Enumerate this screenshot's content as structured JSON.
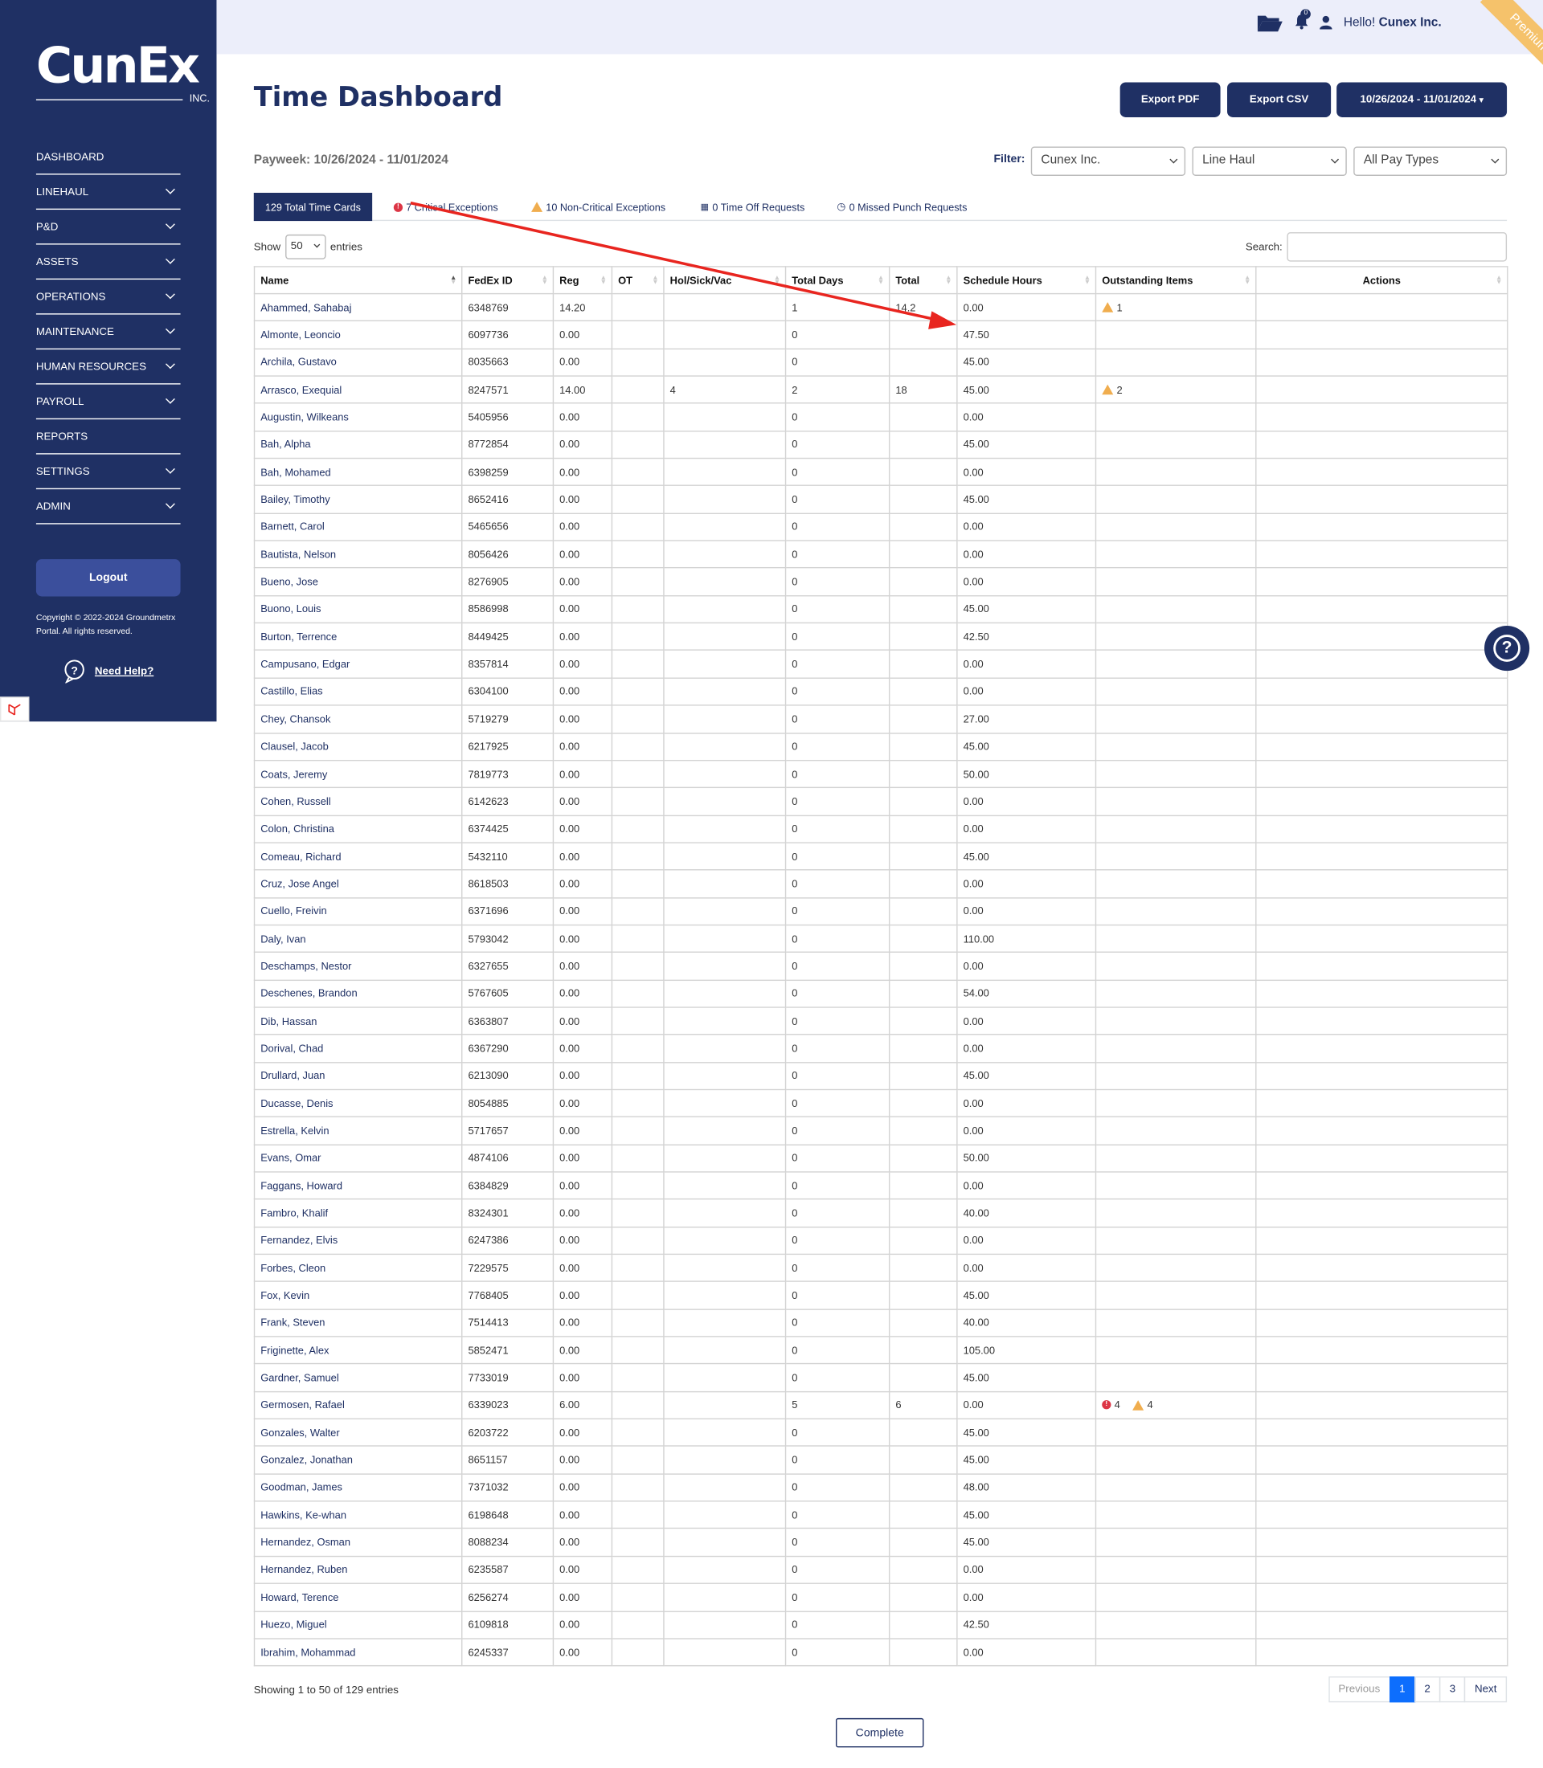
{
  "logo": {
    "word": "CunEx",
    "suffix": "INC."
  },
  "sidebar": {
    "items": [
      {
        "label": "DASHBOARD",
        "chevron": false
      },
      {
        "label": "LINEHAUL",
        "chevron": true
      },
      {
        "label": "P&D",
        "chevron": true
      },
      {
        "label": "ASSETS",
        "chevron": true
      },
      {
        "label": "OPERATIONS",
        "chevron": true
      },
      {
        "label": "MAINTENANCE",
        "chevron": true
      },
      {
        "label": "HUMAN RESOURCES",
        "chevron": true
      },
      {
        "label": "PAYROLL",
        "chevron": true
      },
      {
        "label": "REPORTS",
        "chevron": false
      },
      {
        "label": "SETTINGS",
        "chevron": true
      },
      {
        "label": "ADMIN",
        "chevron": true
      }
    ],
    "logout": "Logout",
    "copyright": "Copyright © 2022-2024 Groundmetrx Portal. All rights reserved.",
    "help": "Need Help?"
  },
  "topbar": {
    "greeting": "Hello!",
    "company": "Cunex Inc.",
    "notification_count": "0",
    "ribbon": "Premium +"
  },
  "page": {
    "title": "Time Dashboard",
    "export_pdf": "Export PDF",
    "export_csv": "Export CSV",
    "date_range": "10/26/2024 - 11/01/2024",
    "payweek_label": "Payweek:",
    "payweek": "10/26/2024 - 11/01/2024",
    "filter_label": "Filter:",
    "filter_company": "Cunex Inc.",
    "filter_dept": "Line Haul",
    "filter_pay": "All Pay Types"
  },
  "tabs": [
    {
      "label": "129 Total Time Cards"
    },
    {
      "label": "7 Critical Exceptions"
    },
    {
      "label": "10 Non-Critical Exceptions"
    },
    {
      "label": "0 Time Off Requests"
    },
    {
      "label": "0 Missed Punch Requests"
    }
  ],
  "table": {
    "show_label": "Show",
    "entries_value": "50",
    "entries_label": "entries",
    "search_label": "Search:",
    "columns": [
      "Name",
      "FedEx ID",
      "Reg",
      "OT",
      "Hol/Sick/Vac",
      "Total Days",
      "Total",
      "Schedule Hours",
      "Outstanding Items",
      "Actions"
    ],
    "rows": [
      [
        "Ahammed, Sahabaj",
        "6348769",
        "14.20",
        "",
        "",
        "1",
        "14.2",
        "0.00",
        "",
        "1"
      ],
      [
        "Almonte, Leoncio",
        "6097736",
        "0.00",
        "",
        "",
        "0",
        "",
        "47.50",
        "",
        ""
      ],
      [
        "Archila, Gustavo",
        "8035663",
        "0.00",
        "",
        "",
        "0",
        "",
        "45.00",
        "",
        ""
      ],
      [
        "Arrasco, Exequial",
        "8247571",
        "14.00",
        "",
        "4",
        "2",
        "18",
        "45.00",
        "",
        "2"
      ],
      [
        "Augustin, Wilkeans",
        "5405956",
        "0.00",
        "",
        "",
        "0",
        "",
        "0.00",
        "",
        ""
      ],
      [
        "Bah, Alpha",
        "8772854",
        "0.00",
        "",
        "",
        "0",
        "",
        "45.00",
        "",
        ""
      ],
      [
        "Bah, Mohamed",
        "6398259",
        "0.00",
        "",
        "",
        "0",
        "",
        "0.00",
        "",
        ""
      ],
      [
        "Bailey, Timothy",
        "8652416",
        "0.00",
        "",
        "",
        "0",
        "",
        "45.00",
        "",
        ""
      ],
      [
        "Barnett, Carol",
        "5465656",
        "0.00",
        "",
        "",
        "0",
        "",
        "0.00",
        "",
        ""
      ],
      [
        "Bautista, Nelson",
        "8056426",
        "0.00",
        "",
        "",
        "0",
        "",
        "0.00",
        "",
        ""
      ],
      [
        "Bueno, Jose",
        "8276905",
        "0.00",
        "",
        "",
        "0",
        "",
        "0.00",
        "",
        ""
      ],
      [
        "Buono, Louis",
        "8586998",
        "0.00",
        "",
        "",
        "0",
        "",
        "45.00",
        "",
        ""
      ],
      [
        "Burton, Terrence",
        "8449425",
        "0.00",
        "",
        "",
        "0",
        "",
        "42.50",
        "",
        ""
      ],
      [
        "Campusano, Edgar",
        "8357814",
        "0.00",
        "",
        "",
        "0",
        "",
        "0.00",
        "",
        ""
      ],
      [
        "Castillo, Elias",
        "6304100",
        "0.00",
        "",
        "",
        "0",
        "",
        "0.00",
        "",
        ""
      ],
      [
        "Chey, Chansok",
        "5719279",
        "0.00",
        "",
        "",
        "0",
        "",
        "27.00",
        "",
        ""
      ],
      [
        "Clausel, Jacob",
        "6217925",
        "0.00",
        "",
        "",
        "0",
        "",
        "45.00",
        "",
        ""
      ],
      [
        "Coats, Jeremy",
        "7819773",
        "0.00",
        "",
        "",
        "0",
        "",
        "50.00",
        "",
        ""
      ],
      [
        "Cohen, Russell",
        "6142623",
        "0.00",
        "",
        "",
        "0",
        "",
        "0.00",
        "",
        ""
      ],
      [
        "Colon, Christina",
        "6374425",
        "0.00",
        "",
        "",
        "0",
        "",
        "0.00",
        "",
        ""
      ],
      [
        "Comeau, Richard",
        "5432110",
        "0.00",
        "",
        "",
        "0",
        "",
        "45.00",
        "",
        ""
      ],
      [
        "Cruz, Jose Angel",
        "8618503",
        "0.00",
        "",
        "",
        "0",
        "",
        "0.00",
        "",
        ""
      ],
      [
        "Cuello, Freivin",
        "6371696",
        "0.00",
        "",
        "",
        "0",
        "",
        "0.00",
        "",
        ""
      ],
      [
        "Daly, Ivan",
        "5793042",
        "0.00",
        "",
        "",
        "0",
        "",
        "110.00",
        "",
        ""
      ],
      [
        "Deschamps, Nestor",
        "6327655",
        "0.00",
        "",
        "",
        "0",
        "",
        "0.00",
        "",
        ""
      ],
      [
        "Deschenes, Brandon",
        "5767605",
        "0.00",
        "",
        "",
        "0",
        "",
        "54.00",
        "",
        ""
      ],
      [
        "Dib, Hassan",
        "6363807",
        "0.00",
        "",
        "",
        "0",
        "",
        "0.00",
        "",
        ""
      ],
      [
        "Dorival, Chad",
        "6367290",
        "0.00",
        "",
        "",
        "0",
        "",
        "0.00",
        "",
        ""
      ],
      [
        "Drullard, Juan",
        "6213090",
        "0.00",
        "",
        "",
        "0",
        "",
        "45.00",
        "",
        ""
      ],
      [
        "Ducasse, Denis",
        "8054885",
        "0.00",
        "",
        "",
        "0",
        "",
        "0.00",
        "",
        ""
      ],
      [
        "Estrella, Kelvin",
        "5717657",
        "0.00",
        "",
        "",
        "0",
        "",
        "0.00",
        "",
        ""
      ],
      [
        "Evans, Omar",
        "4874106",
        "0.00",
        "",
        "",
        "0",
        "",
        "50.00",
        "",
        ""
      ],
      [
        "Faggans, Howard",
        "6384829",
        "0.00",
        "",
        "",
        "0",
        "",
        "0.00",
        "",
        ""
      ],
      [
        "Fambro, Khalif",
        "8324301",
        "0.00",
        "",
        "",
        "0",
        "",
        "40.00",
        "",
        ""
      ],
      [
        "Fernandez, Elvis",
        "6247386",
        "0.00",
        "",
        "",
        "0",
        "",
        "0.00",
        "",
        ""
      ],
      [
        "Forbes, Cleon",
        "7229575",
        "0.00",
        "",
        "",
        "0",
        "",
        "0.00",
        "",
        ""
      ],
      [
        "Fox, Kevin",
        "7768405",
        "0.00",
        "",
        "",
        "0",
        "",
        "45.00",
        "",
        ""
      ],
      [
        "Frank, Steven",
        "7514413",
        "0.00",
        "",
        "",
        "0",
        "",
        "40.00",
        "",
        ""
      ],
      [
        "Friginette, Alex",
        "5852471",
        "0.00",
        "",
        "",
        "0",
        "",
        "105.00",
        "",
        ""
      ],
      [
        "Gardner, Samuel",
        "7733019",
        "0.00",
        "",
        "",
        "0",
        "",
        "45.00",
        "",
        ""
      ],
      [
        "Germosen, Rafael",
        "6339023",
        "6.00",
        "",
        "",
        "5",
        "6",
        "0.00",
        "4",
        "4"
      ],
      [
        "Gonzales, Walter",
        "6203722",
        "0.00",
        "",
        "",
        "0",
        "",
        "45.00",
        "",
        ""
      ],
      [
        "Gonzalez, Jonathan",
        "8651157",
        "0.00",
        "",
        "",
        "0",
        "",
        "45.00",
        "",
        ""
      ],
      [
        "Goodman, James",
        "7371032",
        "0.00",
        "",
        "",
        "0",
        "",
        "48.00",
        "",
        ""
      ],
      [
        "Hawkins, Ke-whan",
        "6198648",
        "0.00",
        "",
        "",
        "0",
        "",
        "45.00",
        "",
        ""
      ],
      [
        "Hernandez, Osman",
        "8088234",
        "0.00",
        "",
        "",
        "0",
        "",
        "45.00",
        "",
        ""
      ],
      [
        "Hernandez, Ruben",
        "6235587",
        "0.00",
        "",
        "",
        "0",
        "",
        "0.00",
        "",
        ""
      ],
      [
        "Howard, Terence",
        "6256274",
        "0.00",
        "",
        "",
        "0",
        "",
        "0.00",
        "",
        ""
      ],
      [
        "Huezo, Miguel",
        "6109818",
        "0.00",
        "",
        "",
        "0",
        "",
        "42.50",
        "",
        ""
      ],
      [
        "Ibrahim, Mohammad",
        "6245337",
        "0.00",
        "",
        "",
        "0",
        "",
        "0.00",
        "",
        ""
      ]
    ],
    "info": "Showing 1 to 50 of 129 entries",
    "pager": {
      "previous": "Previous",
      "pages": [
        "1",
        "2",
        "3"
      ],
      "next": "Next"
    },
    "complete": "Complete"
  },
  "colors": {
    "brand": "#1f3064",
    "critical": "#dc3545",
    "warning": "#f0ad4e",
    "annotation": "#e8251f"
  }
}
